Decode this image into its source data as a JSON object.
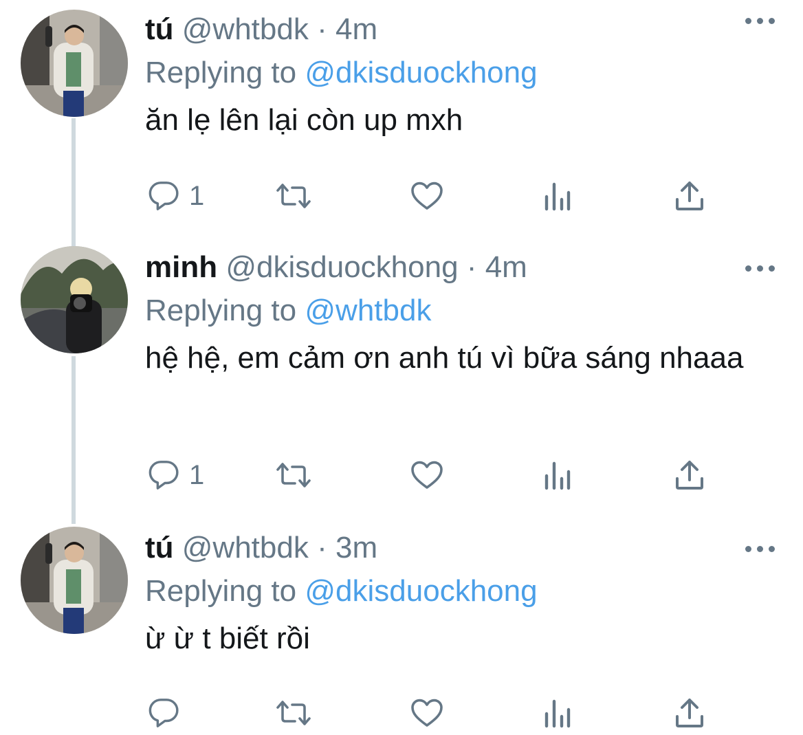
{
  "tweets": [
    {
      "name": "tú",
      "handle": "@whtbdk",
      "sep": "·",
      "time": "4m",
      "replying_prefix": "Replying to",
      "replying_to": "@dkisduockhong",
      "text": "ăn lẹ lên lại còn up mxh",
      "reply_count": "1",
      "avatar": "tú avatar"
    },
    {
      "name": "minh",
      "handle": "@dkisduockhong",
      "sep": "·",
      "time": "4m",
      "replying_prefix": "Replying to",
      "replying_to": "@whtbdk",
      "text": "hệ hệ, em cảm ơn anh tú vì bữa sáng nhaaa",
      "reply_count": "1",
      "avatar": "minh avatar"
    },
    {
      "name": "tú",
      "handle": "@whtbdk",
      "sep": "·",
      "time": "3m",
      "replying_prefix": "Replying to",
      "replying_to": "@dkisduockhong",
      "text": "ừ ừ t biết rồi",
      "reply_count": "",
      "avatar": "tú avatar"
    }
  ],
  "colors": {
    "text": "#14171a",
    "secondary": "#657786",
    "mention": "#4a9fe8",
    "thread_line": "#cfd9de"
  },
  "icons": [
    "reply-icon",
    "retweet-icon",
    "like-icon",
    "analytics-icon",
    "share-icon",
    "more-icon"
  ]
}
